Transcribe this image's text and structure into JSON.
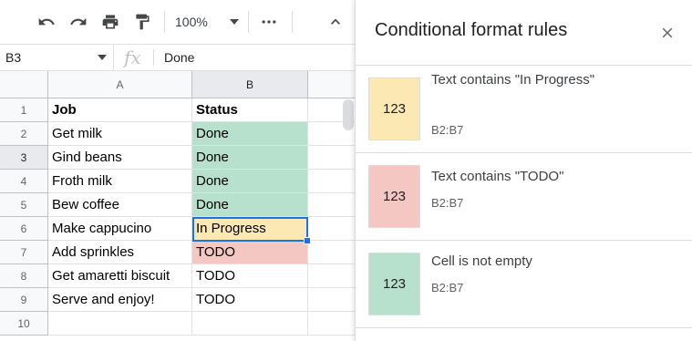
{
  "toolbar": {
    "zoom": "100%",
    "icons": [
      "undo-icon",
      "redo-icon",
      "print-icon",
      "paint-format-icon",
      "more-icon",
      "collapse-icon"
    ]
  },
  "formula_bar": {
    "cell_ref": "B3",
    "fx_label": "fx",
    "value": "Done"
  },
  "sheet": {
    "columns": [
      "A",
      "B"
    ],
    "row_numbers": [
      "1",
      "2",
      "3",
      "4",
      "5",
      "6",
      "7",
      "8",
      "9",
      "10"
    ],
    "rows": [
      {
        "a": "Job",
        "b": "Status",
        "bg": ""
      },
      {
        "a": "Get milk",
        "b": "Done",
        "bg": "#b7e1cd"
      },
      {
        "a": "Gind beans",
        "b": "Done",
        "bg": "#b7e1cd"
      },
      {
        "a": "Froth milk",
        "b": "Done",
        "bg": "#b7e1cd"
      },
      {
        "a": "Bew coffee",
        "b": "Done",
        "bg": "#b7e1cd"
      },
      {
        "a": "Make cappucino",
        "b": "In Progress",
        "bg": "#fce8b2"
      },
      {
        "a": "Add sprinkles",
        "b": "TODO",
        "bg": "#f4c7c3"
      },
      {
        "a": "Get amaretti biscuit",
        "b": "TODO",
        "bg": ""
      },
      {
        "a": "Serve and enjoy!",
        "b": "TODO",
        "bg": ""
      },
      {
        "a": "",
        "b": "",
        "bg": ""
      }
    ],
    "selected_cell": "B3"
  },
  "panel": {
    "title": "Conditional format rules",
    "rules": [
      {
        "preview": "123",
        "title": "Text contains \"In Progress\"",
        "range": "B2:B7",
        "color": "#fce8b2"
      },
      {
        "preview": "123",
        "title": "Text contains \"TODO\"",
        "range": "B2:B7",
        "color": "#f4c7c3"
      },
      {
        "preview": "123",
        "title": "Cell is not empty",
        "range": "B2:B7",
        "color": "#b7e1cd"
      }
    ]
  },
  "colors": {
    "selection": "#1a73e8",
    "header_bg": "#f8f9fa",
    "active_header_bg": "#e8eaed"
  }
}
